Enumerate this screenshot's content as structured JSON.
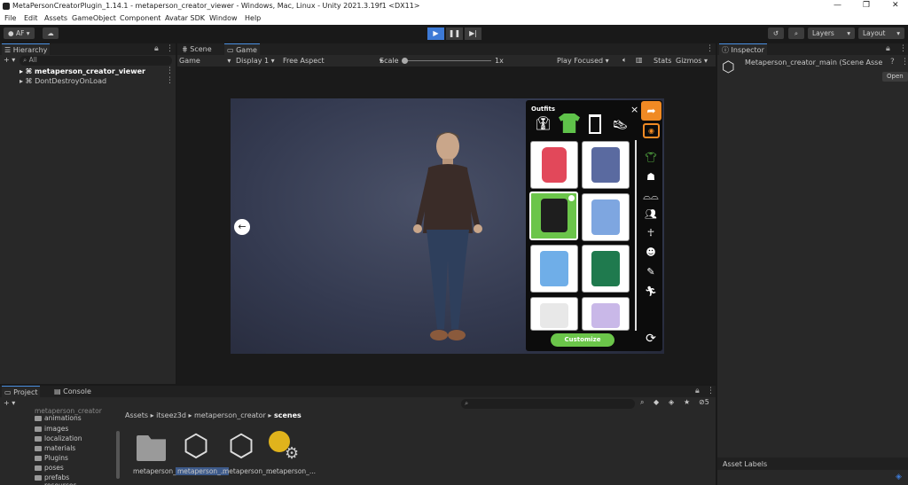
{
  "window": {
    "title": "MetaPersonCreatorPlugin_1.14.1 - metaperson_creator_viewer - Windows, Mac, Linux - Unity 2021.3.19f1 <DX11>"
  },
  "menu": [
    "File",
    "Edit",
    "Assets",
    "GameObject",
    "Component",
    "Avatar SDK",
    "Window",
    "Help"
  ],
  "toolbar": {
    "account": "AF",
    "layers": "Layers",
    "layout": "Layout"
  },
  "hierarchy": {
    "tab": "Hierarchy",
    "search": "All",
    "items": [
      "metaperson_creator_viewer",
      "DontDestroyOnLoad"
    ]
  },
  "sceneTabs": {
    "scene": "Scene",
    "game": "Game"
  },
  "gameBar": {
    "mode": "Game",
    "display": "Display 1",
    "aspect": "Free Aspect",
    "scale_label": "Scale",
    "scale_value": "1x",
    "play_focused": "Play Focused",
    "stats": "Stats",
    "gizmos": "Gizmos"
  },
  "avatarUI": {
    "heading": "Outfits",
    "close": "×",
    "customize": "Customize"
  },
  "inspector": {
    "tab": "Inspector",
    "object": "Metaperson_creator_main (Scene Asse",
    "open": "Open",
    "asset_labels": "Asset Labels"
  },
  "project": {
    "tab_project": "Project",
    "tab_console": "Console",
    "tree": [
      "metaperson_creator",
      "animations",
      "images",
      "localization",
      "materials",
      "Plugins",
      "poses",
      "prefabs",
      "resources"
    ],
    "breadcrumb": [
      "Assets",
      "itseez3d",
      "metaperson_creator",
      "scenes"
    ],
    "assets": [
      "metaperson_...",
      "metaperson_...",
      "metaperson_...",
      "metaperson_..."
    ],
    "count": "5"
  },
  "colors": {
    "accent": "#3d7ad6",
    "green": "#6bc54a",
    "orange": "#f08a24"
  }
}
